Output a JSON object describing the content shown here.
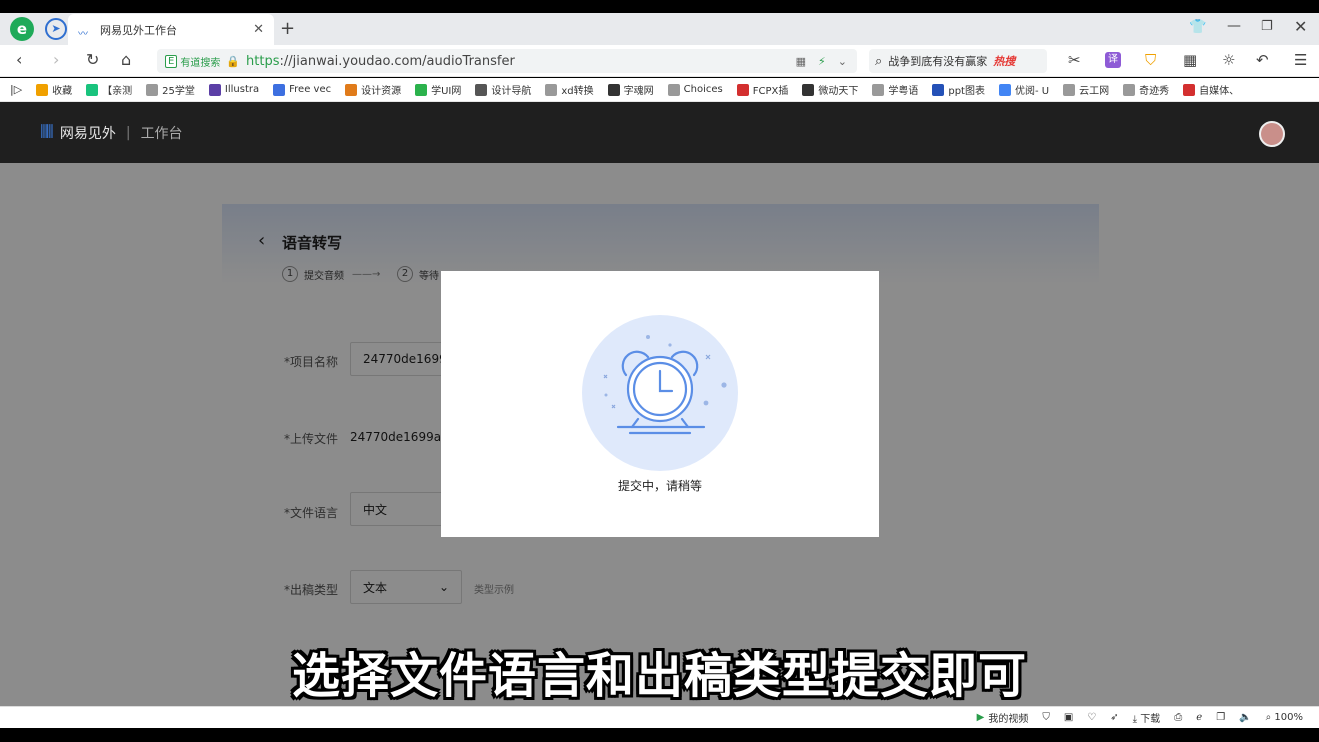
{
  "browser": {
    "tab_title": "网易见外工作台",
    "url_badge": "E",
    "search_engine": "有道搜索",
    "url_scheme": "https",
    "url_rest": "://jianwai.youdao.com/audioTransfer",
    "search_query": "战争到底有没有赢家",
    "search_hot": "热搜"
  },
  "bookmarks": [
    {
      "label": "收藏",
      "color": "#f0a000"
    },
    {
      "label": "【亲测",
      "color": "#19c37d"
    },
    {
      "label": "25学堂",
      "color": "#999999"
    },
    {
      "label": "Illustra",
      "color": "#5b3fa6"
    },
    {
      "label": "Free vec",
      "color": "#3d6fe0"
    },
    {
      "label": "设计资源",
      "color": "#e07b1a"
    },
    {
      "label": "学UI网",
      "color": "#2bb24c"
    },
    {
      "label": "设计导航",
      "color": "#555555"
    },
    {
      "label": "xd转换",
      "color": "#999999"
    },
    {
      "label": "字魂网",
      "color": "#333333"
    },
    {
      "label": "Choices",
      "color": "#999999"
    },
    {
      "label": "FCPX插",
      "color": "#d32f2f"
    },
    {
      "label": "微动天下",
      "color": "#333333"
    },
    {
      "label": "学粤语",
      "color": "#999999"
    },
    {
      "label": "ppt图表",
      "color": "#2451b7"
    },
    {
      "label": "优阅- U",
      "color": "#4285f4"
    },
    {
      "label": "云工网",
      "color": "#999999"
    },
    {
      "label": "奇迹秀",
      "color": "#999999"
    },
    {
      "label": "自媒体、",
      "color": "#d32f2f"
    }
  ],
  "app": {
    "brand": "网易见外",
    "section": "工作台"
  },
  "page": {
    "title": "语音转写",
    "steps": [
      {
        "num": "1",
        "label": "提交音频"
      },
      {
        "num": "2",
        "label": "等待"
      }
    ],
    "form": {
      "project_label": "*项目名称",
      "project_value": "24770de1699",
      "upload_label": "*上传文件",
      "upload_value": "24770de1699aa",
      "language_label": "*文件语言",
      "language_value": "中文",
      "output_label": "*出稿类型",
      "output_value": "文本",
      "output_example": "类型示例"
    }
  },
  "modal": {
    "message": "提交中，请稍等"
  },
  "subtitle": "选择文件语言和出稿类型提交即可",
  "statusbar": {
    "video": "我的视频",
    "download": "下载",
    "zoom": "100%"
  }
}
